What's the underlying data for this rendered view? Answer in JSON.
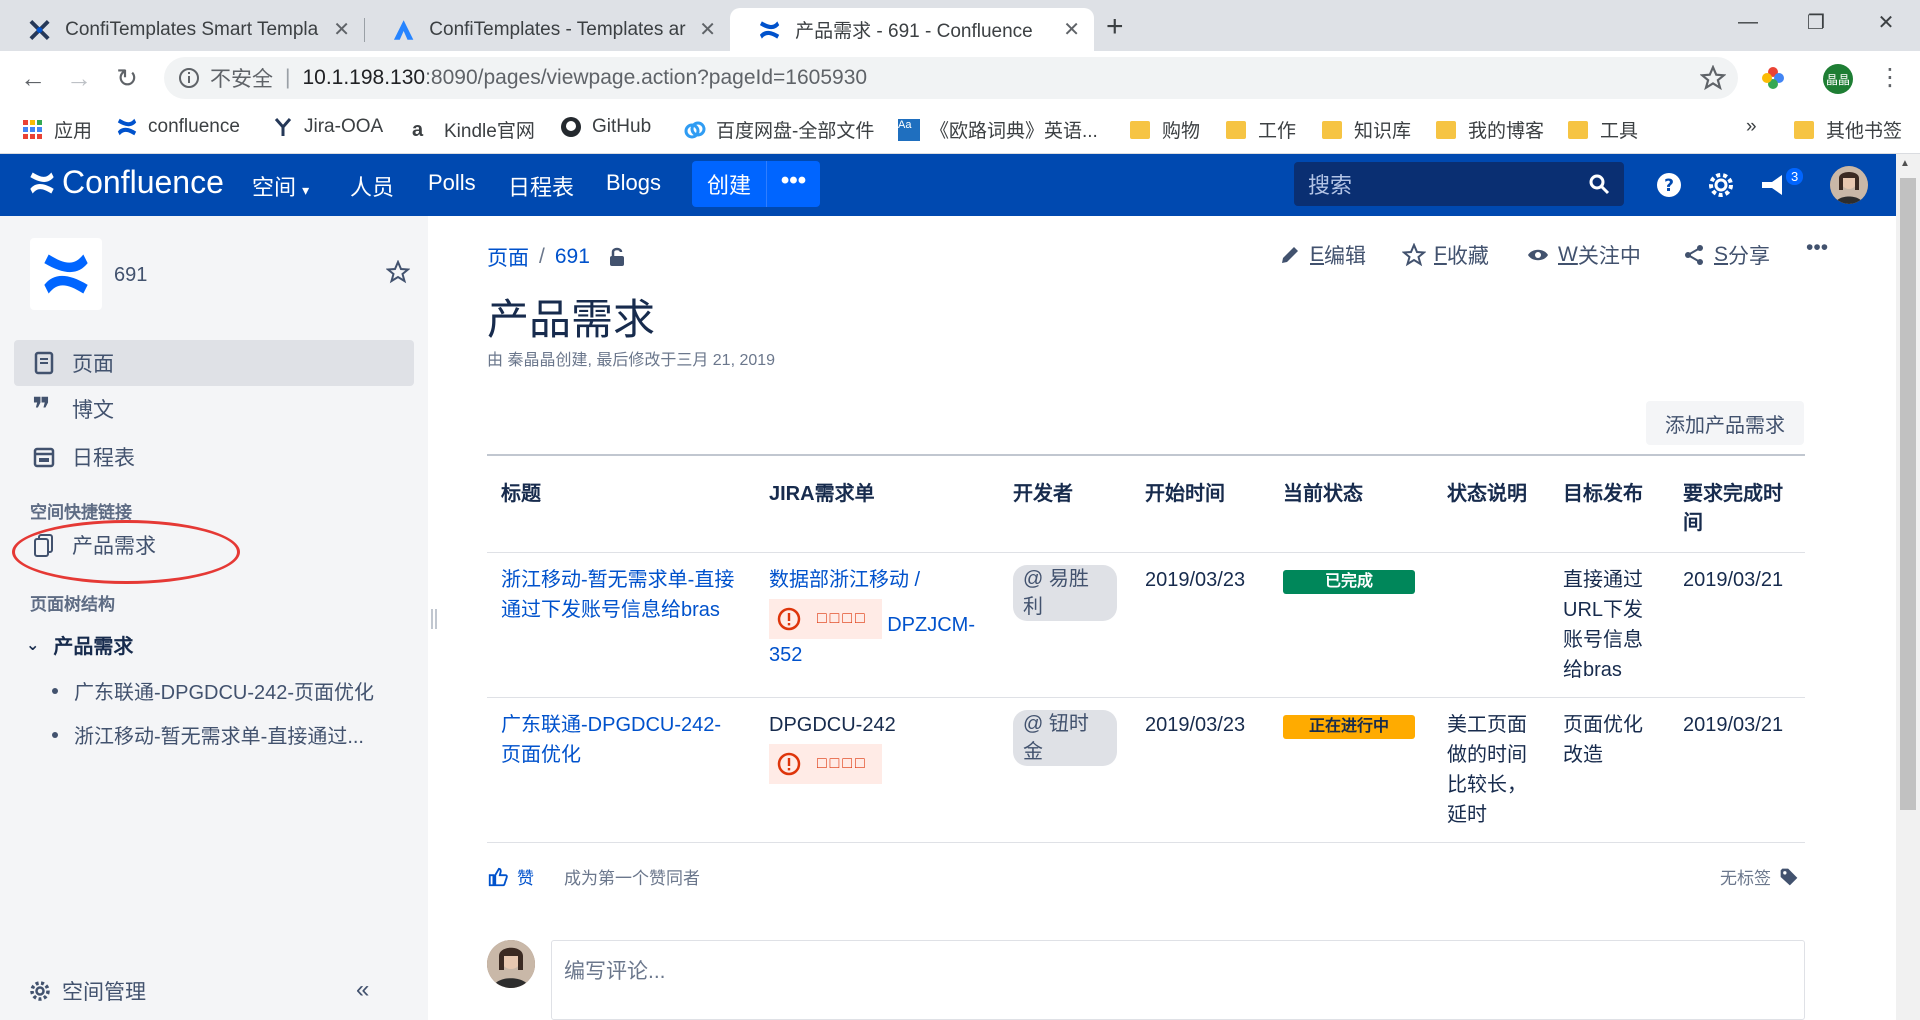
{
  "browser": {
    "tabs": [
      {
        "title": "ConfiTemplates Smart Templa",
        "close": "✕"
      },
      {
        "title": "ConfiTemplates - Templates ar",
        "close": "✕"
      },
      {
        "title": "产品需求 - 691 - Confluence",
        "close": "✕"
      }
    ],
    "new_tab": "+",
    "window_controls": {
      "minimize": "—",
      "restore": "❐",
      "close": "✕"
    },
    "address": {
      "security_label": "不安全",
      "host": "10.1.198.130",
      "path": ":8090/pages/viewpage.action?pageId=1605930"
    },
    "profile_label": "晶晶",
    "bookmarks": [
      {
        "label": "应用",
        "icon": "apps-grid-icon"
      },
      {
        "label": "confluence",
        "icon": "confluence-icon"
      },
      {
        "label": "Jira-OOA",
        "icon": "jira-icon"
      },
      {
        "label": "Kindle官网",
        "icon": "amazon-icon"
      },
      {
        "label": "GitHub",
        "icon": "github-icon"
      },
      {
        "label": "百度网盘-全部文件",
        "icon": "baidu-pan-icon"
      },
      {
        "label": "《欧路词典》英语...",
        "icon": "eudic-icon"
      },
      {
        "label": "购物",
        "icon": "folder-icon"
      },
      {
        "label": "工作",
        "icon": "folder-icon"
      },
      {
        "label": "知识库",
        "icon": "folder-icon"
      },
      {
        "label": "我的博客",
        "icon": "folder-icon"
      },
      {
        "label": "工具",
        "icon": "folder-icon"
      }
    ],
    "bookmarks_more": "»",
    "other_bookmarks": "其他书签"
  },
  "header": {
    "logo_text": "Confluence",
    "nav": [
      "空间",
      "人员",
      "Polls",
      "日程表",
      "Blogs"
    ],
    "create_label": "创建",
    "create_more": "•••",
    "search_placeholder": "搜索",
    "notification_count": "3",
    "colors": {
      "bar": "#0049b0",
      "create": "#0065ff"
    }
  },
  "sidebar": {
    "space_name": "691",
    "items": [
      {
        "label": "页面",
        "icon": "page-icon"
      },
      {
        "label": "博文",
        "icon": "quote-icon"
      },
      {
        "label": "日程表",
        "icon": "calendar-icon"
      }
    ],
    "shortcuts_heading": "空间快捷链接",
    "shortcut": "产品需求",
    "tree_heading": "页面树结构",
    "tree_root": "产品需求",
    "tree_children": [
      "广东联通-DPGDCU-242-页面优化",
      "浙江移动-暂无需求单-直接通过..."
    ],
    "admin_label": "空间管理",
    "collapse": "«"
  },
  "main": {
    "breadcrumb": [
      "页面",
      "691"
    ],
    "breadcrumb_sep": "/",
    "actions": [
      {
        "key": "E",
        "label": "编辑",
        "icon": "pencil-icon"
      },
      {
        "key": "F",
        "label": "收藏",
        "icon": "star-icon"
      },
      {
        "key": "W",
        "label": "关注中",
        "icon": "eye-icon"
      },
      {
        "key": "S",
        "label": "分享",
        "icon": "share-icon"
      }
    ],
    "more": "•••",
    "title": "产品需求",
    "meta": "由 秦晶晶创建, 最后修改于三月 21, 2019",
    "add_button": "添加产品需求",
    "table": {
      "headers": [
        "标题",
        "JIRA需求单",
        "开发者",
        "开始时间",
        "当前状态",
        "状态说明",
        "目标发布",
        "要求完成时间"
      ],
      "rows": [
        {
          "title": "浙江移动-暂无需求单-直接通过下发账号信息给bras",
          "jira_link": "数据部浙江移动 /",
          "jira_error": "□□□□",
          "jira_key": "DPZJCM-352",
          "developer": "@ 易胜利",
          "start": "2019/03/23",
          "status": "已完成",
          "status_note": "",
          "target": "直接通过URL下发账号信息给bras",
          "due": "2019/03/21"
        },
        {
          "title": "广东联通-DPGDCU-242-页面优化",
          "jira_link": "DPGDCU-242",
          "jira_error": "□□□□",
          "jira_key": "",
          "developer": "@ 钮时金",
          "start": "2019/03/23",
          "status": "正在进行中",
          "status_note": "美工页面做的时间比较长，延时",
          "target": "页面优化改造",
          "due": "2019/03/21"
        }
      ]
    },
    "like_label": "赞",
    "like_desc": "成为第一个赞同者",
    "labels": "无标签",
    "comment_placeholder": "编写评论..."
  }
}
